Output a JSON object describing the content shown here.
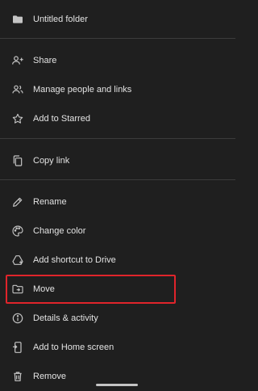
{
  "header": {
    "title": "Untitled folder",
    "icon": "folder-icon"
  },
  "menu": {
    "items": [
      {
        "label": "Share",
        "icon": "person-add-icon"
      },
      {
        "label": "Manage people and links",
        "icon": "people-icon"
      },
      {
        "label": "Add to Starred",
        "icon": "star-icon"
      },
      {
        "label": "Copy link",
        "icon": "copy-icon"
      },
      {
        "label": "Rename",
        "icon": "pencil-icon"
      },
      {
        "label": "Change color",
        "icon": "palette-icon"
      },
      {
        "label": "Add shortcut to Drive",
        "icon": "drive-shortcut-icon"
      },
      {
        "label": "Move",
        "icon": "move-folder-icon",
        "highlighted": true
      },
      {
        "label": "Details & activity",
        "icon": "info-icon"
      },
      {
        "label": "Add to Home screen",
        "icon": "home-screen-icon"
      },
      {
        "label": "Remove",
        "icon": "trash-icon"
      }
    ]
  },
  "colors": {
    "background": "#1f1f1f",
    "text": "#e3e3e3",
    "highlight": "#e0242b",
    "divider": "#3c3c3c"
  }
}
